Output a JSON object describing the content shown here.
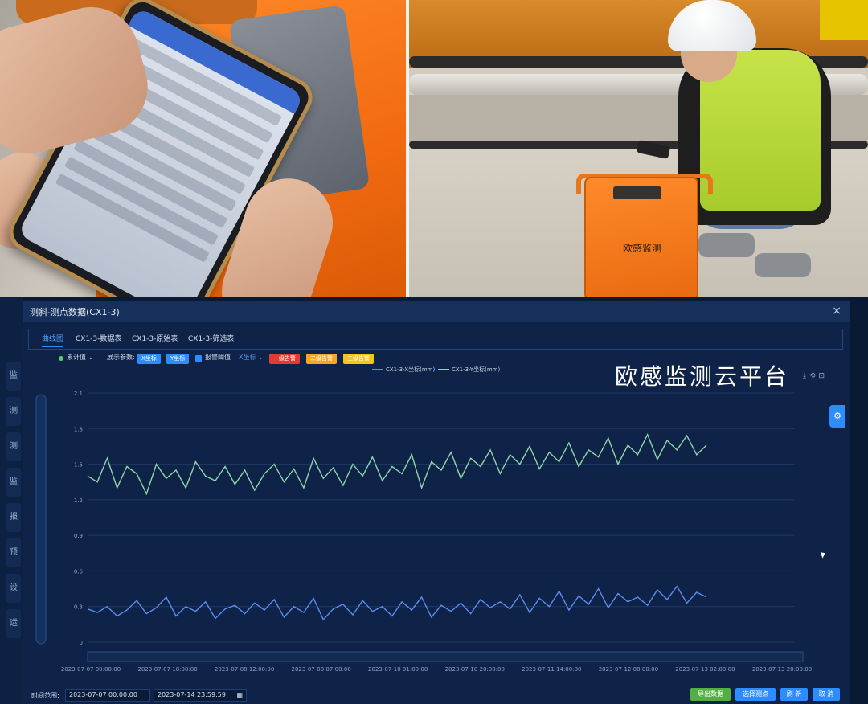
{
  "dialog": {
    "title": "测斜-测点数据(CX1-3)",
    "close": "×"
  },
  "tabs": [
    {
      "label": "曲线图",
      "active": true
    },
    {
      "label": "CX1-3-数据表"
    },
    {
      "label": "CX1-3-原始表"
    },
    {
      "label": "CX1-3-筛选表"
    }
  ],
  "toolbar": {
    "mode": "累计值",
    "display_params_label": "展示参数:",
    "x_btn": "X坐标",
    "y_btn": "Y坐标",
    "alarm_check": "报警阈值",
    "axis_select": "X坐标",
    "alarm1": "一级告警",
    "alarm2": "二级告警",
    "alarm3": "三级告警",
    "colors": {
      "alarm1": "#e53935",
      "alarm2": "#f5a623",
      "alarm3": "#f5c518",
      "primary": "#2d8cff"
    }
  },
  "watermark": "欧感监测云平台",
  "device_logo": "欧感监测",
  "footer": {
    "range_label": "时间范围:",
    "start": "2023-07-07 00:00:00",
    "end": "2023-07-14 23:59:59",
    "export": "导出数据",
    "select_points": "选择测点",
    "refresh": "刷 新",
    "cancel": "取 消"
  },
  "sidebar": [
    "监",
    "测",
    "测",
    "监",
    "报",
    "预",
    "设",
    "运"
  ],
  "chart_data": {
    "type": "line",
    "x_tick_labels": [
      "2023-07-07 00:00:00",
      "2023-07-07 18:00:00",
      "2023-07-08 12:00:00",
      "2023-07-09 07:00:00",
      "2023-07-10 01:00:00",
      "2023-07-10 20:00:00",
      "2023-07-11 14:00:00",
      "2023-07-12 08:00:00",
      "2023-07-13 02:00:00",
      "2023-07-13 20:00:00"
    ],
    "ylim": [
      0,
      2.1
    ],
    "y_ticks": [
      "0",
      "0.3",
      "0.6",
      "0.9",
      "1.2",
      "1.5",
      "1.8",
      "2.1"
    ],
    "series": [
      {
        "name": "CX1-3-X坐标(mm)",
        "color": "#5b8def",
        "values": [
          0.28,
          0.25,
          0.3,
          0.22,
          0.27,
          0.35,
          0.24,
          0.29,
          0.38,
          0.22,
          0.3,
          0.26,
          0.34,
          0.2,
          0.28,
          0.31,
          0.24,
          0.33,
          0.27,
          0.36,
          0.21,
          0.3,
          0.25,
          0.37,
          0.19,
          0.28,
          0.32,
          0.23,
          0.35,
          0.26,
          0.3,
          0.22,
          0.34,
          0.27,
          0.38,
          0.21,
          0.31,
          0.26,
          0.33,
          0.24,
          0.36,
          0.29,
          0.34,
          0.28,
          0.4,
          0.25,
          0.37,
          0.3,
          0.43,
          0.27,
          0.39,
          0.32,
          0.45,
          0.29,
          0.41,
          0.34,
          0.38,
          0.31,
          0.44,
          0.36,
          0.47,
          0.33,
          0.42,
          0.38
        ]
      },
      {
        "name": "CX1-3-Y坐标(mm)",
        "color": "#8fd6a8",
        "values": [
          1.4,
          1.35,
          1.55,
          1.3,
          1.48,
          1.42,
          1.25,
          1.5,
          1.38,
          1.45,
          1.3,
          1.52,
          1.4,
          1.36,
          1.48,
          1.33,
          1.45,
          1.28,
          1.42,
          1.5,
          1.35,
          1.46,
          1.3,
          1.55,
          1.38,
          1.47,
          1.32,
          1.5,
          1.4,
          1.56,
          1.36,
          1.48,
          1.42,
          1.58,
          1.3,
          1.52,
          1.45,
          1.6,
          1.38,
          1.55,
          1.48,
          1.62,
          1.42,
          1.58,
          1.5,
          1.65,
          1.46,
          1.6,
          1.52,
          1.68,
          1.48,
          1.62,
          1.56,
          1.72,
          1.5,
          1.66,
          1.58,
          1.75,
          1.54,
          1.7,
          1.62,
          1.74,
          1.58,
          1.66
        ]
      }
    ],
    "grid": true,
    "legend": "top-center"
  }
}
